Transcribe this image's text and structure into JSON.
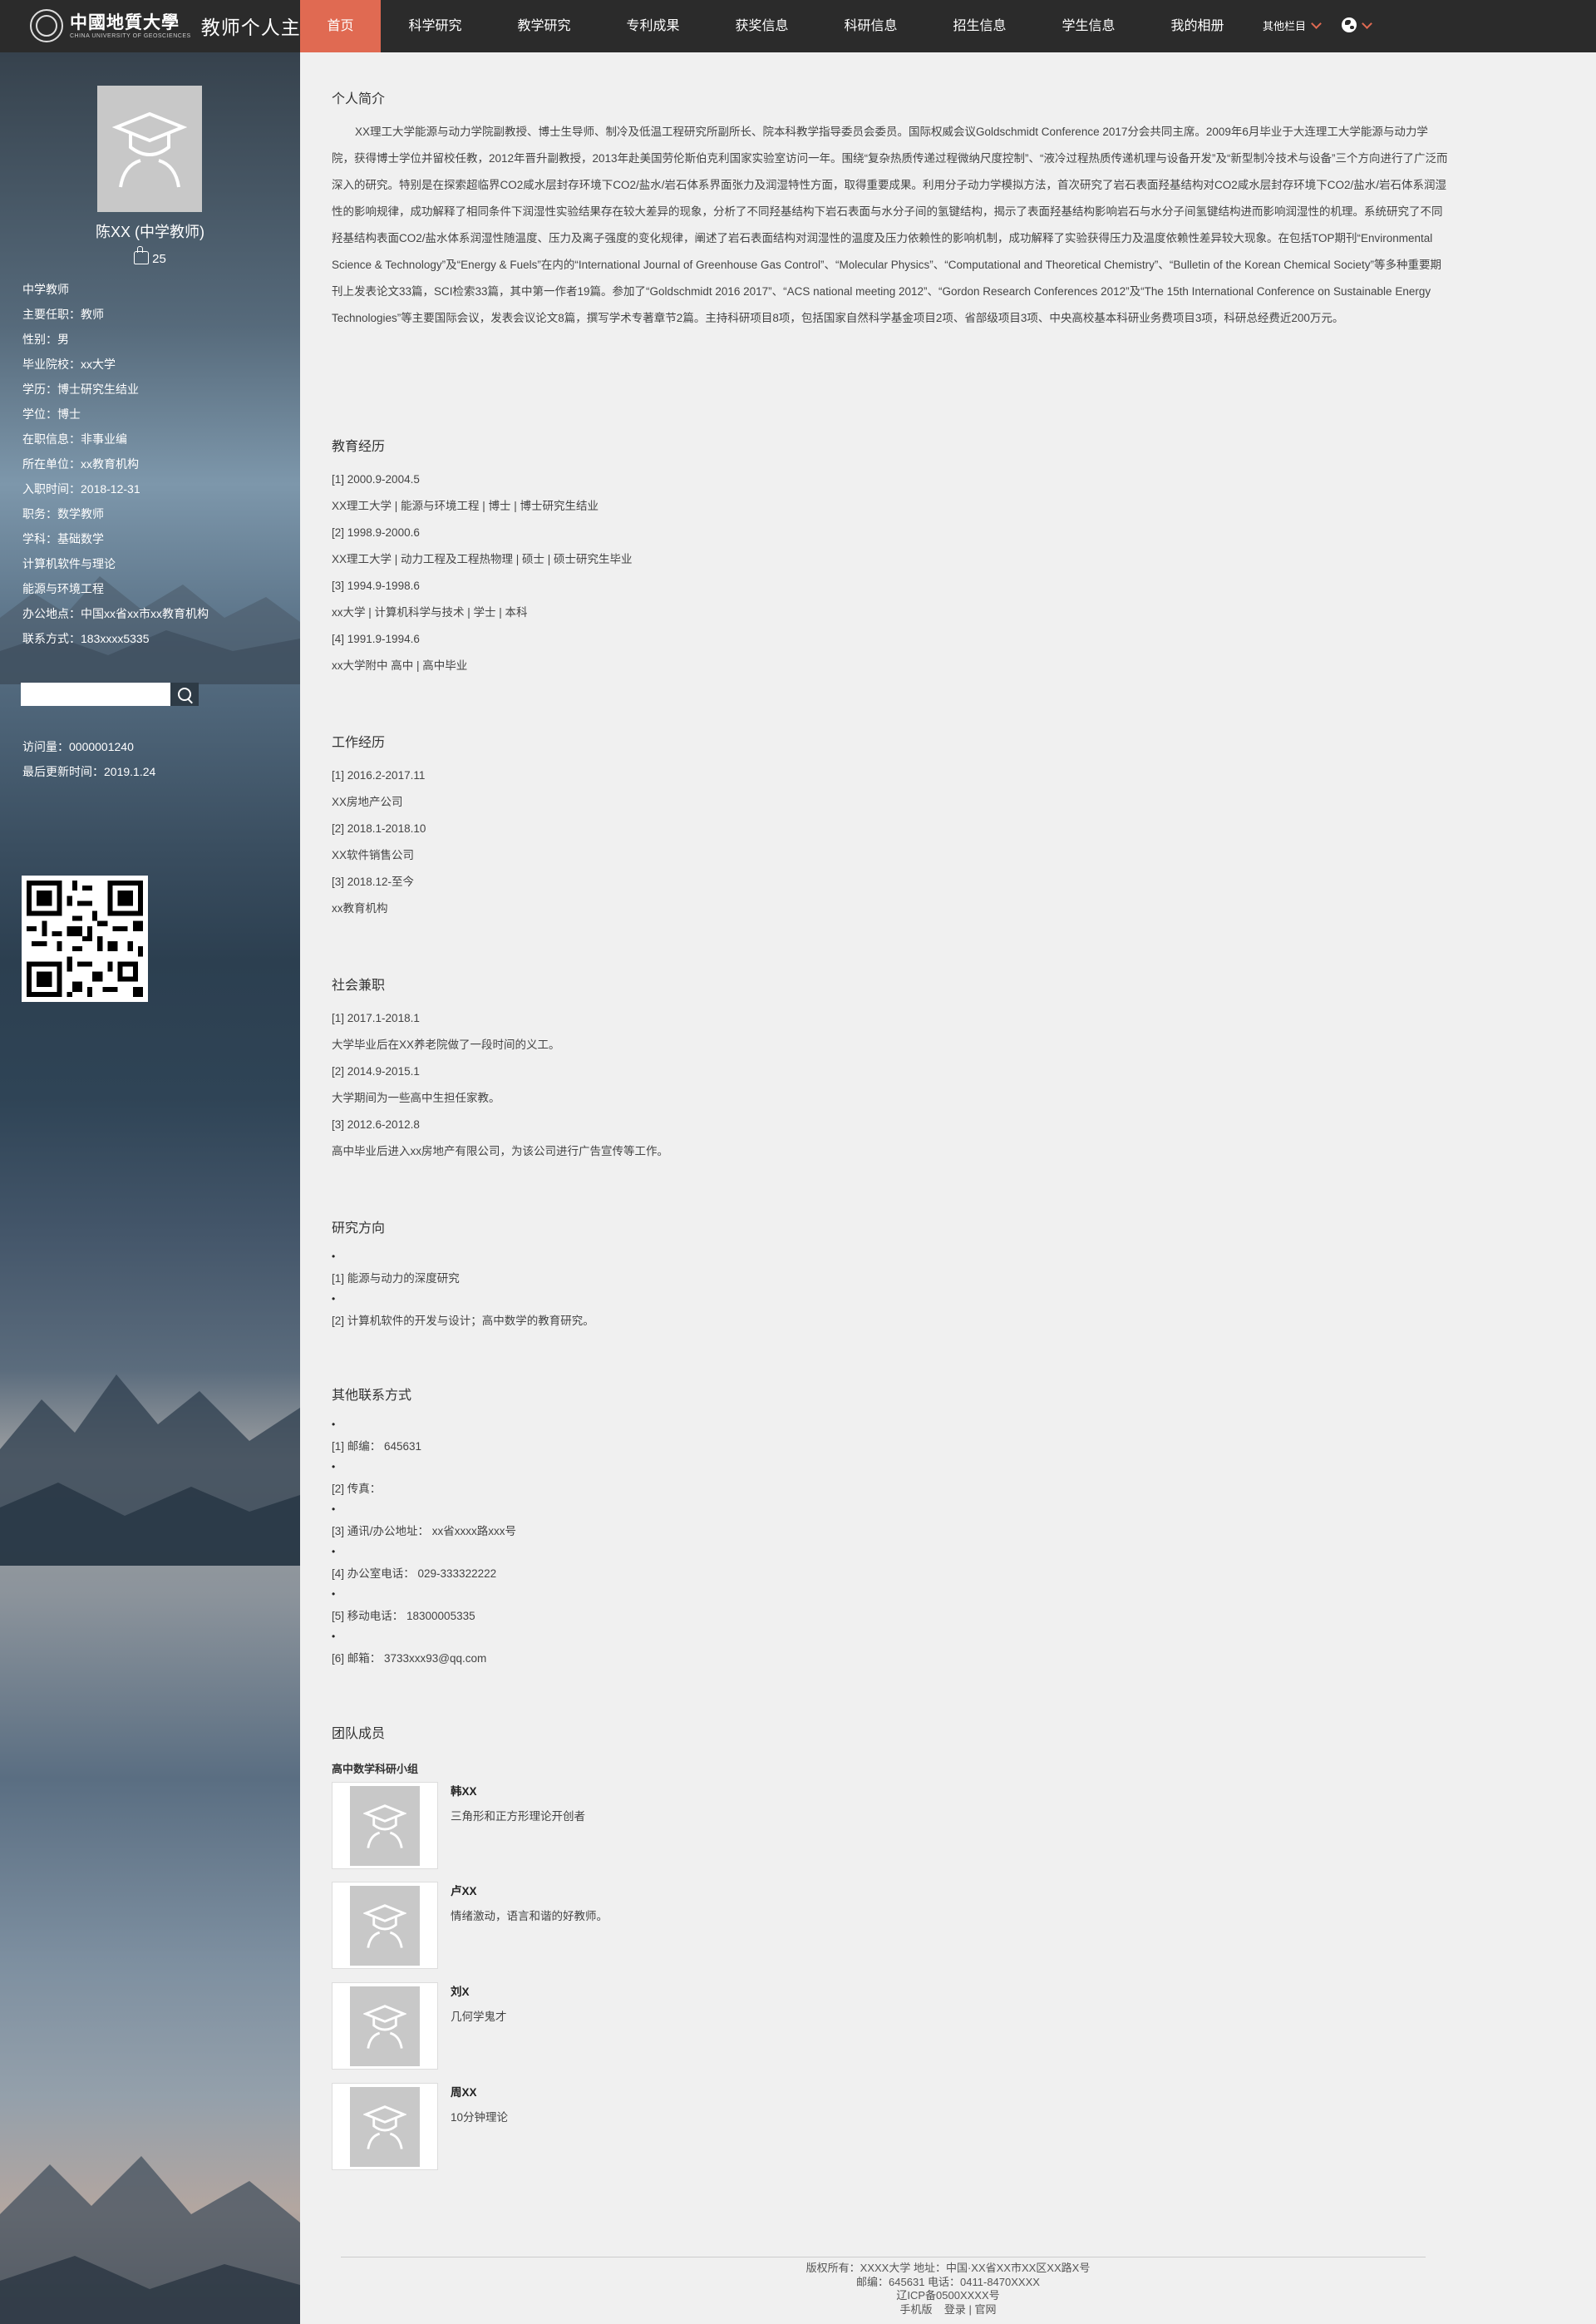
{
  "header": {
    "logo_cn": "中國地質大學",
    "logo_en": "CHINA UNIVERSITY OF GEOSCIENCES",
    "site_title": "教师个人主页",
    "nav": [
      {
        "label": "首页",
        "active": true
      },
      {
        "label": "科学研究"
      },
      {
        "label": "教学研究"
      },
      {
        "label": "专利成果"
      },
      {
        "label": "获奖信息"
      },
      {
        "label": "科研信息"
      },
      {
        "label": "招生信息"
      },
      {
        "label": "学生信息"
      },
      {
        "label": "我的相册"
      }
    ],
    "more_label": "其他栏目",
    "accent_color": "#e06a52"
  },
  "sidebar": {
    "name": "陈XX (中学教师)",
    "likes": "25",
    "info": [
      "中学教师",
      "主要任职：教师",
      "性别：男",
      "毕业院校：xx大学",
      "学历：博士研究生结业",
      "学位：博士",
      "在职信息：非事业编",
      "所在单位：xx教育机构",
      "入职时间：2018-12-31",
      "职务：数学教师",
      "学科：基础数学",
      "计算机软件与理论",
      "能源与环境工程",
      "办公地点：中国xx省xx市xx教育机构",
      "联系方式：183xxxx5335"
    ],
    "search": {
      "value": "",
      "placeholder": ""
    },
    "visits": "访问量：0000001240",
    "last_update": "最后更新时间：2019.1.24"
  },
  "main": {
    "intro": {
      "title": "个人简介",
      "text": "XX理工大学能源与动力学院副教授、博士生导师、制冷及低温工程研究所副所长、院本科教学指导委员会委员。国际权威会议Goldschmidt Conference 2017分会共同主席。2009年6月毕业于大连理工大学能源与动力学院，获得博士学位并留校任教，2012年晋升副教授，2013年赴美国劳伦斯伯克利国家实验室访问一年。围绕“复杂热质传递过程微纳尺度控制”、“液冷过程热质传递机理与设备开发”及“新型制冷技术与设备”三个方向进行了广泛而深入的研究。特别是在探索超临界CO2咸水层封存环境下CO2/盐水/岩石体系界面张力及润湿特性方面，取得重要成果。利用分子动力学模拟方法，首次研究了岩石表面羟基结构对CO2咸水层封存环境下CO2/盐水/岩石体系润湿性的影响规律，成功解释了相同条件下润湿性实验结果存在较大差异的现象，分析了不同羟基结构下岩石表面与水分子间的氢键结构，揭示了表面羟基结构影响岩石与水分子间氢键结构进而影响润湿性的机理。系统研究了不同羟基结构表面CO2/盐水体系润湿性随温度、压力及离子强度的变化规律，阐述了岩石表面结构对润湿性的温度及压力依赖性的影响机制，成功解释了实验获得压力及温度依赖性差异较大现象。在包括TOP期刊“Environmental Science & Technology”及“Energy & Fuels”在内的“International Journal of Greenhouse Gas Control”、“Molecular Physics”、“Computational and Theoretical Chemistry”、“Bulletin of the Korean Chemical Society”等多种重要期刊上发表论文33篇，SCI检索33篇，其中第一作者19篇。参加了“Goldschmidt 2016 2017”、“ACS national meeting 2012”、“Gordon Research Conferences 2012”及“The 15th International Conference on Sustainable Energy Technologies”等主要国际会议，发表会议论文8篇，撰写学术专著章节2篇。主持科研项目8项，包括国家自然科学基金项目2项、省部级项目3项、中央高校基本科研业务费项目3项，科研总经费近200万元。"
    },
    "education": {
      "title": "教育经历",
      "rows": [
        "[1]    2000.9-2004.5",
        "XX理工大学  |  能源与环境工程  |  博士  |  博士研究生结业",
        "[2]    1998.9-2000.6",
        "XX理工大学  |  动力工程及工程热物理  |  硕士  |  硕士研究生毕业",
        "[3]    1994.9-1998.6",
        "xx大学  |  计算机科学与技术  |  学士  |  本科",
        "[4]    1991.9-1994.6",
        "xx大学附中 高中  |  高中毕业"
      ]
    },
    "work": {
      "title": "工作经历",
      "rows": [
        "[1]    2016.2-2017.11",
        "XX房地产公司",
        "[2]    2018.1-2018.10",
        "XX软件销售公司",
        "[3]    2018.12-至今",
        "xx教育机构"
      ]
    },
    "social": {
      "title": "社会兼职",
      "rows": [
        "[1]    2017.1-2018.1",
        "大学毕业后在XX养老院做了一段时间的义工。",
        "[2]    2014.9-2015.1",
        "大学期间为一些高中生担任家教。",
        "[3]    2012.6-2012.8",
        "高中毕业后进入xx房地产有限公司，为该公司进行广告宣传等工作。"
      ]
    },
    "research": {
      "title": "研究方向",
      "items": [
        "[1]    能源与动力的深度研究",
        "[2]    计算机软件的开发与设计；高中数学的教育研究。"
      ]
    },
    "contact": {
      "title": "其他联系方式",
      "items": [
        "[1]  邮编：  645631",
        "[2]  传真：",
        "[3]  通讯/办公地址：  xx省xxxx路xxx号",
        "[4]  办公室电话：  029-333322222",
        "[5]  移动电话：  18300005335",
        "[6]  邮箱：  3733xxx93@qq.com"
      ]
    },
    "team": {
      "title": "团队成员",
      "group": "高中数学科研小组",
      "members": [
        {
          "name": "韩XX",
          "desc": "三角形和正方形理论开创者"
        },
        {
          "name": "卢XX",
          "desc": "情绪激动，语言和谐的好教师。"
        },
        {
          "name": "刘X",
          "desc": "几何学鬼才"
        },
        {
          "name": "周XX",
          "desc": "10分钟理论"
        }
      ]
    }
  },
  "footer": {
    "line1": "版权所有：XXXX大学   地址：中国·XX省XX市XX区XX路X号",
    "line2": "邮编：645631    电话：0411-8470XXXX",
    "line3": "辽ICP备0500XXXX号",
    "mobile": "手机版",
    "login": "登录",
    "official": "官网"
  }
}
